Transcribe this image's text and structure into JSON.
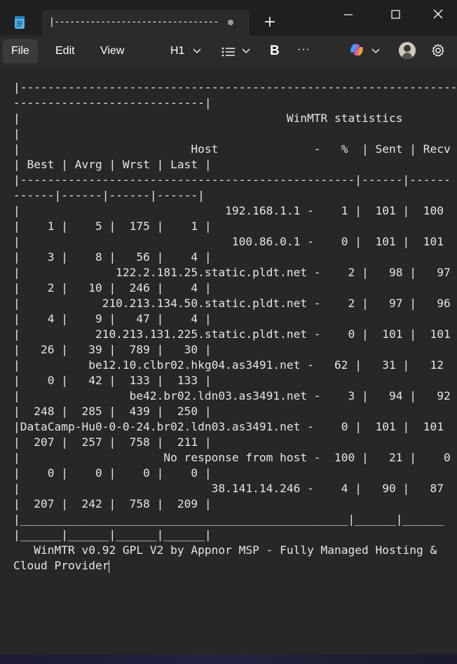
{
  "app": {
    "icon": "notepad-icon",
    "tab_title": "|----------------------------------------------------------------",
    "new_tab_icon": "plus-icon",
    "window_buttons": [
      "minimize-icon",
      "maximize-icon",
      "close-icon"
    ]
  },
  "menu": {
    "file": "File",
    "edit": "Edit",
    "view": "View"
  },
  "toolbar": {
    "heading": "H1",
    "bold": "B",
    "more": "···",
    "icons": [
      "chevron-down-icon",
      "list-icon",
      "copilot-icon",
      "avatar",
      "gear-icon"
    ]
  },
  "document": {
    "lines": [
      "|----------------------------------------------------------------",
      "----------------------------|",
      "|                                       WinMTR statistics",
      "|",
      "|                         Host              -   %  | Sent | Recv",
      "| Best | Avrg | Wrst | Last |",
      "|-------------------------------------------------|------|------",
      "------|------|------|------|",
      "|                              192.168.1.1 -    1 |  101 |  100",
      "|    1 |    5 |  175 |    1 |",
      "|                               100.86.0.1 -    0 |  101 |  101",
      "|    3 |    8 |   56 |    4 |",
      "|              122.2.181.25.static.pldt.net -    2 |   98 |   97",
      "|    2 |   10 |  246 |    4 |",
      "|            210.213.134.50.static.pldt.net -    2 |   97 |   96",
      "|    4 |    9 |   47 |    4 |",
      "|           210.213.131.225.static.pldt.net -    0 |  101 |  101",
      "|   26 |   39 |  789 |   30 |",
      "|          be12.10.clbr02.hkg04.as3491.net -   62 |   31 |   12",
      "|    0 |   42 |  133 |  133 |",
      "|                be42.br02.ldn03.as3491.net -    3 |   94 |   92",
      "|  248 |  285 |  439 |  250 |",
      "|DataCamp-Hu0-0-0-24.br02.ldn03.as3491.net -    0 |  101 |  101",
      "|  207 |  257 |  758 |  211 |",
      "|                     No response from host -  100 |   21 |    0",
      "|    0 |    0 |    0 |    0 |",
      "|                            38.141.14.246 -    4 |   90 |   87",
      "|  207 |  242 |  758 |  209 |",
      "|________________________________________________|______|______",
      "|______|______|______|______|",
      "   WinMTR v0.92 GPL V2 by Appnor MSP - Fully Managed Hosting &",
      "Cloud Provider"
    ]
  }
}
